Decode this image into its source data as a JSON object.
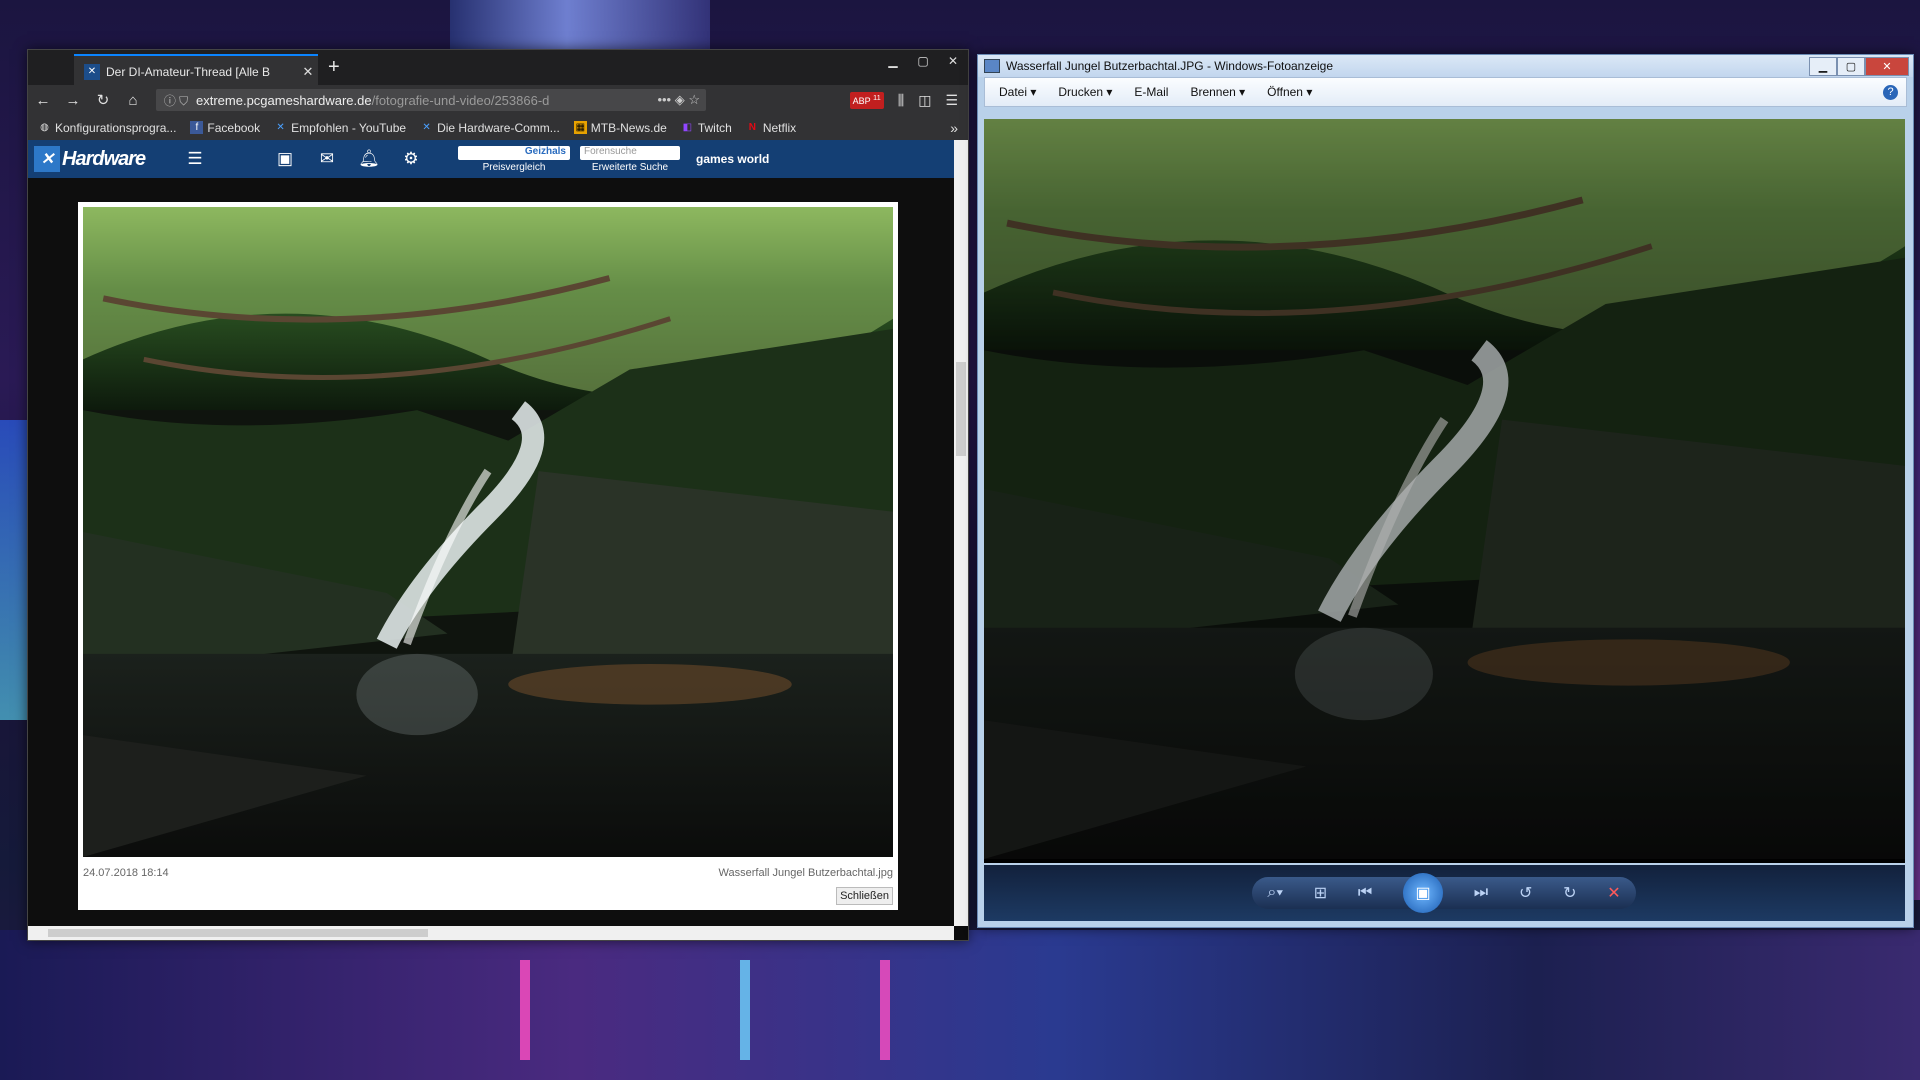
{
  "browser": {
    "tab_title": "Der DI-Amateur-Thread [Alle B",
    "new_tab": "+",
    "url_domain": "extreme.pcgameshardware.de",
    "url_path": "/fotografie-und-video/253866-d",
    "url_more": "•••",
    "abp_badge": "11",
    "bookmarks": [
      {
        "label": "Konfigurationsprogra...",
        "icon": "globe-icon"
      },
      {
        "label": "Facebook",
        "icon": "facebook-icon"
      },
      {
        "label": "Empfohlen - YouTube",
        "icon": "pcgh-icon"
      },
      {
        "label": "Die Hardware-Comm...",
        "icon": "pcgh-icon"
      },
      {
        "label": "MTB-News.de",
        "icon": "mtb-icon"
      },
      {
        "label": "Twitch",
        "icon": "twitch-icon"
      },
      {
        "label": "Netflix",
        "icon": "netflix-icon"
      }
    ],
    "site": {
      "logo_text": "Hardware",
      "geizhals_label": "Preisvergleich",
      "geizhals_brand": "Geizhals",
      "forum_placeholder": "Forensuche",
      "forum_label": "Erweiterte Suche",
      "games_world": "games world"
    },
    "lightbox": {
      "date": "24.07.2018 18:14",
      "filename": "Wasserfall Jungel Butzerbachtal.jpg",
      "close_label": "Schließen"
    }
  },
  "viewer": {
    "title": "Wasserfall Jungel Butzerbachtal.JPG - Windows-Fotoanzeige",
    "menu": [
      "Datei",
      "Drucken",
      "E-Mail",
      "Brennen",
      "Öffnen"
    ],
    "help": "?"
  },
  "colors": {
    "site_header": "#143f74",
    "firefox_accent": "#0a84ff",
    "viewer_chrome": "#b9d1ea"
  }
}
